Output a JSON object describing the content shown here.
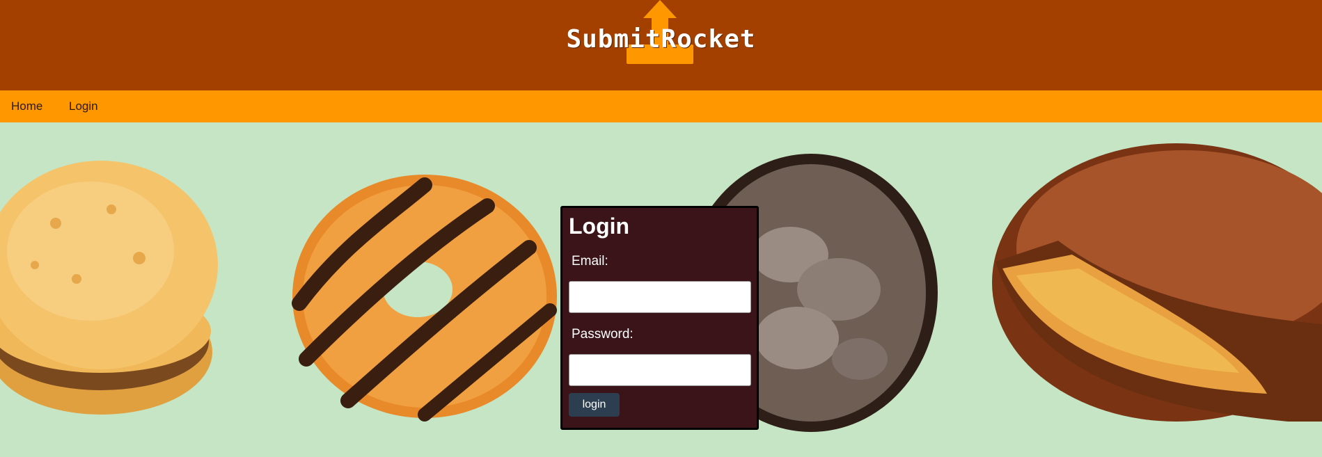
{
  "header": {
    "logo_text": "SubmitRocket",
    "logo_icon": "upload-arrow-icon",
    "background": "#a34000",
    "accent": "#ff9800"
  },
  "nav": {
    "items": [
      {
        "label": "Home"
      },
      {
        "label": "Login"
      }
    ],
    "background": "#ff9800"
  },
  "background_images": [
    {
      "name": "shortbread-sandwich-cookie-image"
    },
    {
      "name": "caramel-coconut-cookie-image"
    },
    {
      "name": "chocolate-mint-cookie-image"
    },
    {
      "name": "peanut-butter-patty-cookie-image"
    }
  ],
  "login_form": {
    "title": "Login",
    "email_label": "Email:",
    "email_value": "",
    "password_label": "Password:",
    "password_value": "",
    "submit_label": "login",
    "background": "#3a1418",
    "button_color": "#2c3e50"
  }
}
